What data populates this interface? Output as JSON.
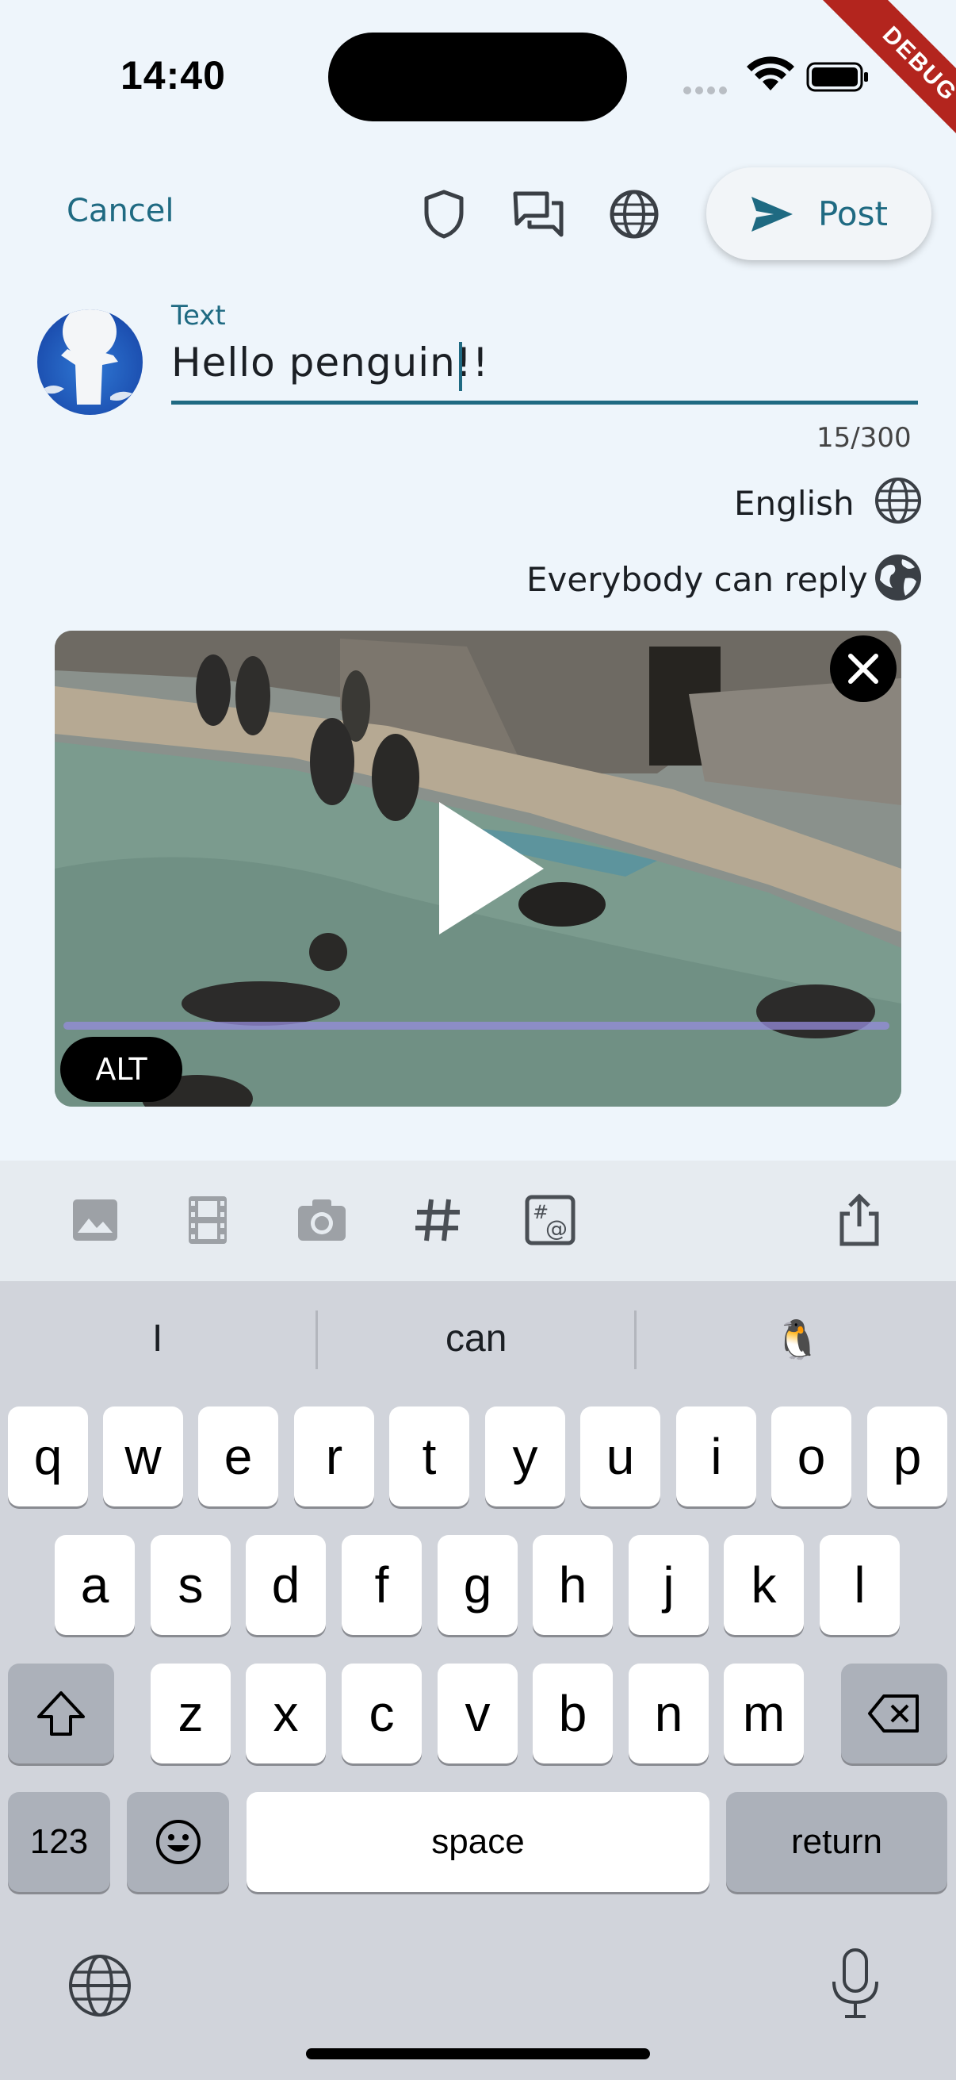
{
  "status_bar": {
    "time": "14:40",
    "debug_banner": "DEBUG"
  },
  "header": {
    "cancel_label": "Cancel",
    "post_label": "Post",
    "icons": [
      "shield-icon",
      "conversation-icon",
      "globe-icon",
      "send-icon"
    ]
  },
  "compose": {
    "field_label": "Text",
    "text_value": "Hello penguin!!",
    "counter": "15/300",
    "language": "English",
    "reply_setting": "Everybody can reply"
  },
  "media": {
    "alt_label": "ALT",
    "video_progress": 0.0
  },
  "toolbar": {
    "icons": [
      "image-icon",
      "film-icon",
      "camera-icon",
      "hashtag-icon",
      "mention-tag-icon",
      "share-icon"
    ]
  },
  "keyboard": {
    "suggestions": [
      "I",
      "can",
      "🐧"
    ],
    "row1": [
      "q",
      "w",
      "e",
      "r",
      "t",
      "y",
      "u",
      "i",
      "o",
      "p"
    ],
    "row2": [
      "a",
      "s",
      "d",
      "f",
      "g",
      "h",
      "j",
      "k",
      "l"
    ],
    "row3": [
      "z",
      "x",
      "c",
      "v",
      "b",
      "n",
      "m"
    ],
    "numbers_label": "123",
    "space_label": "space",
    "return_label": "return"
  },
  "colors": {
    "accent": "#1f6a82",
    "background": "#eef5fb",
    "debug": "#b3251e"
  }
}
